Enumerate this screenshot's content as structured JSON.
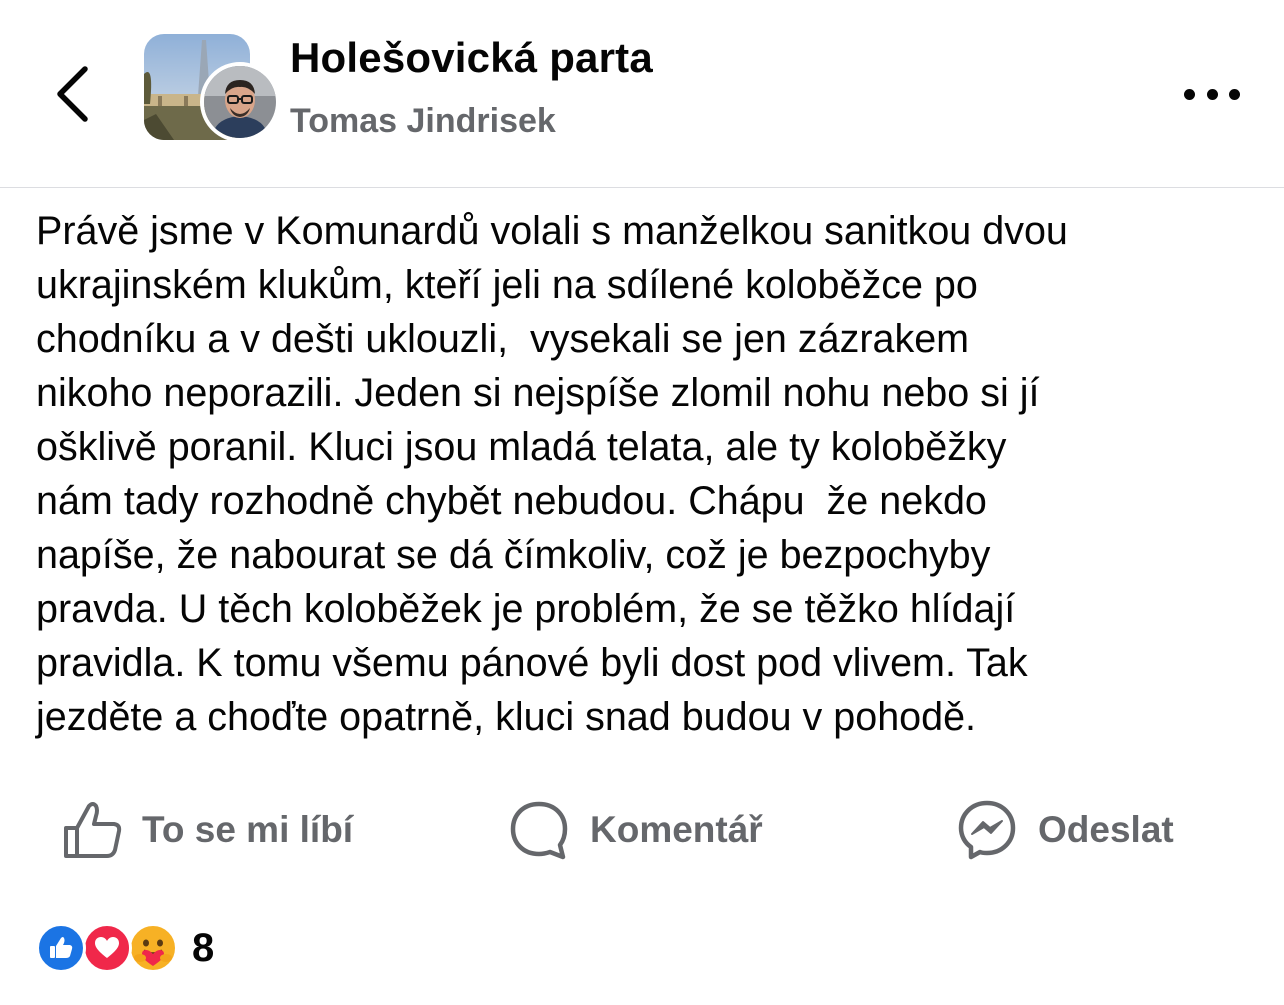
{
  "header": {
    "group_name": "Holešovická parta",
    "author_name": "Tomas Jindrisek",
    "back_icon": "chevron-left-icon",
    "more_icon": "more-horizontal-icon"
  },
  "post": {
    "lines": [
      "Právě jsme v Komunardů volali s manželkou sanitkou dvou",
      "ukrajinském klukům, kteří jeli na sdílené koloběžce po",
      "chodníku a v dešti uklouzli,  vysekali se jen zázrakem",
      "nikoho neporazili. Jeden si nejspíše zlomil nohu nebo si jí",
      "ošklivě poranil. Kluci jsou mladá telata, ale ty koloběžky",
      "nám tady rozhodně chybět nebudou. Chápu  že nekdo",
      "napíše, že nabourat se dá čímkoliv, což je bezpochyby",
      "pravda. U těch koloběžek je problém, že se těžko hlídají",
      "pravidla. K tomu všemu pánové byli dost pod vlivem. Tak",
      "jezděte a choďte opatrně, kluci snad budou v pohodě."
    ]
  },
  "actions": {
    "like_label": "To se mi líbí",
    "comment_label": "Komentář",
    "share_label": "Odeslat"
  },
  "reactions": {
    "types": [
      "like",
      "love",
      "care"
    ],
    "count": "8"
  },
  "colors": {
    "text": "#050505",
    "secondary": "#65676b",
    "like_blue": "#1b74e4",
    "love_red": "#f0284a",
    "care_yellow": "#f7b125"
  }
}
